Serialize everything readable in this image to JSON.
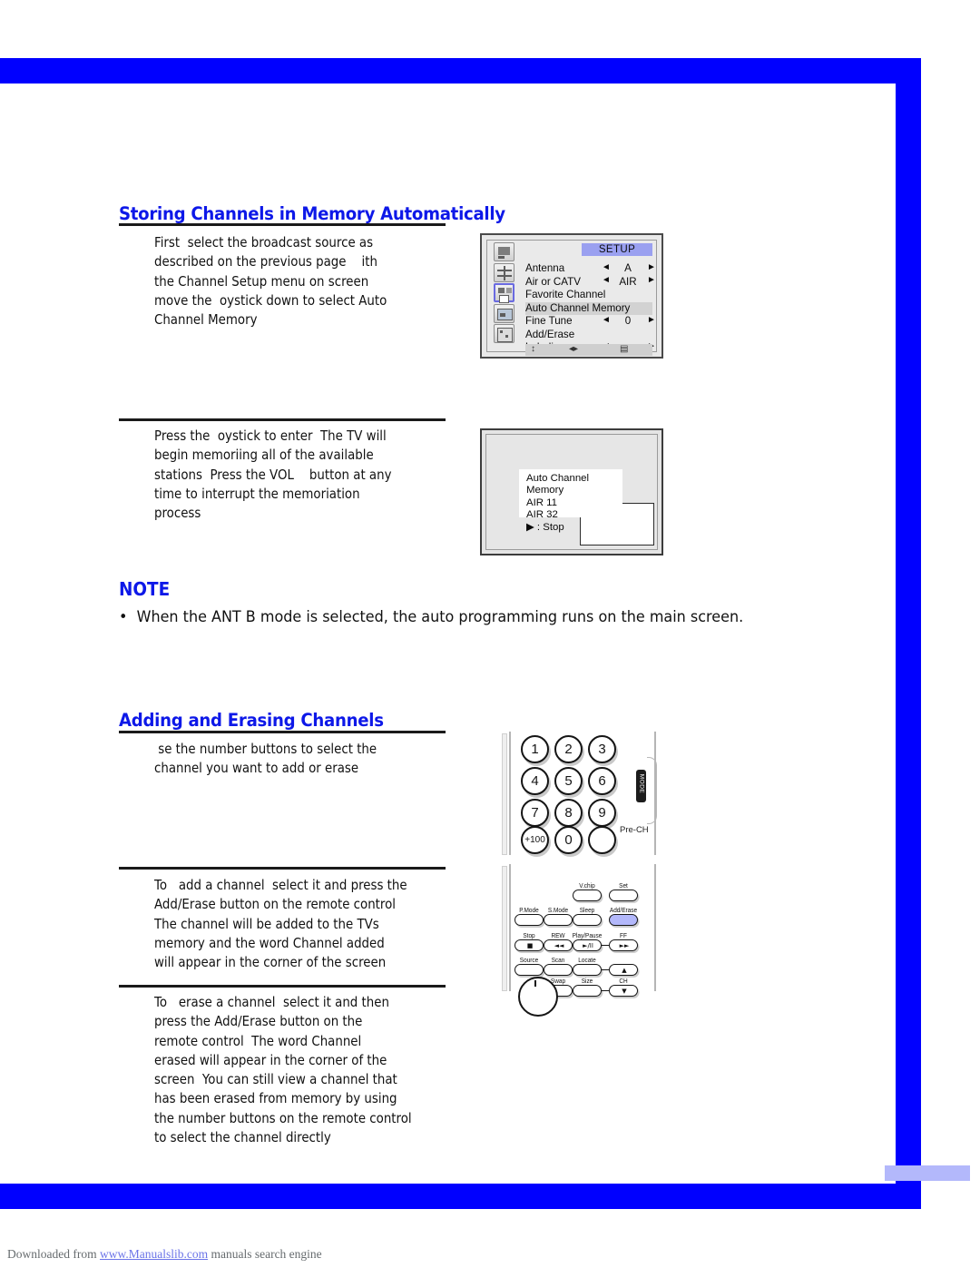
{
  "page": {
    "frame_color": "#0000ff",
    "accent_color": "#b3b8fb"
  },
  "sections": [
    {
      "id": "storing",
      "heading": "Storing Channels in Memory Automatically",
      "steps": [
        "First  select the broadcast source as\ndescribed on the previous page    ith\nthe Channel Setup menu on screen\nmove the  oystick down to select Auto\nChannel Memory",
        "Press the  oystick to enter  The TV will\nbegin memoriing all of the available\nstations  Press the VOL    button at any\ntime to interrupt the memoriation\nprocess"
      ]
    },
    {
      "id": "adding",
      "heading": "Adding and Erasing Channels",
      "steps": [
        " se the number buttons to select the\nchannel you want to add or erase",
        "To   add a channel  select it and press the\nAdd/Erase button on the remote control\nThe channel will be added to the TVs\nmemory and the word Channel added\nwill appear in the corner of the screen",
        "To   erase a channel  select it and then\npress the Add/Erase button on the\nremote control  The word Channel\nerased will appear in the corner of the\nscreen  You can still view a channel that\nhas been erased from memory by using\nthe number buttons on the remote control\nto select the channel directly"
      ]
    }
  ],
  "note": {
    "title": "NOTE",
    "bullet": "•  When the ANT B mode is selected, the auto programming runs on the main screen."
  },
  "tv_setup_screen": {
    "title": "SETUP",
    "rows": [
      {
        "label": "Antenna",
        "left": "◄",
        "value": "A",
        "right": "►",
        "highlighted": false
      },
      {
        "label": "Air or CATV",
        "left": "◄",
        "value": "AIR",
        "right": "►",
        "highlighted": false
      },
      {
        "label": "Favorite Channel",
        "left": "",
        "value": "",
        "right": "",
        "highlighted": false
      },
      {
        "label": "Auto Channel Memory",
        "left": "",
        "value": "",
        "right": "",
        "highlighted": true
      },
      {
        "label": "Fine Tune",
        "left": "◄",
        "value": "0",
        "right": "►",
        "highlighted": false
      },
      {
        "label": "Add/Erase",
        "left": "",
        "value": "",
        "right": "",
        "highlighted": false
      },
      {
        "label": "Labeling",
        "left": "◄",
        "value": "- - - -",
        "right": "►",
        "highlighted": false
      }
    ],
    "footer_glyphs": [
      "↕",
      "◀▶",
      "⌸"
    ],
    "sidebar_icons": [
      "picture-icon",
      "audio-icon",
      "channel-icon",
      "screen-icon",
      "function-icon"
    ],
    "selected_sidebar_index": 2
  },
  "tv_memory_screen": {
    "lines": [
      "Auto Channel Memory",
      "AIR 11",
      "AIR  32",
      "▶  :   Stop"
    ]
  },
  "remote_keypad": {
    "buttons": [
      [
        "1",
        "2",
        "3"
      ],
      [
        "4",
        "5",
        "6"
      ],
      [
        "7",
        "8",
        "9"
      ],
      [
        "+100",
        "0",
        ""
      ]
    ],
    "pre_ch_label": "Pre-CH",
    "mode_label": "MODE"
  },
  "remote_functions": {
    "row0": [
      {
        "label": "V.chip",
        "glyph": "",
        "highlighted": false
      },
      {
        "label": "Set",
        "glyph": "",
        "highlighted": false
      }
    ],
    "row1": [
      {
        "label": "P.Mode",
        "glyph": "",
        "highlighted": false
      },
      {
        "label": "S.Mode",
        "glyph": "",
        "highlighted": false
      },
      {
        "label": "Sleep",
        "glyph": "",
        "highlighted": false
      },
      {
        "label": "Add/Erase",
        "glyph": "",
        "highlighted": true
      }
    ],
    "row2": [
      {
        "label": "Stop",
        "glyph": "■",
        "highlighted": false
      },
      {
        "label": "REW",
        "glyph": "◄◄",
        "highlighted": false
      },
      {
        "label": "Play/Pause",
        "glyph": "►/II",
        "highlighted": false
      },
      {
        "label": "FF",
        "glyph": "►►",
        "highlighted": false
      }
    ],
    "row3": [
      {
        "label": "Source",
        "glyph": "",
        "highlighted": false
      },
      {
        "label": "Scan",
        "glyph": "",
        "highlighted": false
      },
      {
        "label": "Locate",
        "glyph": "",
        "highlighted": false
      },
      {
        "label": "",
        "glyph": "▲",
        "highlighted": false
      }
    ],
    "row4": [
      {
        "label": "Swap",
        "glyph": "",
        "highlighted": false
      },
      {
        "label": "Size",
        "glyph": "",
        "highlighted": false
      },
      {
        "label": "CH",
        "glyph": "▼",
        "highlighted": false
      }
    ]
  },
  "footer": {
    "prefix": "Downloaded from ",
    "link": "www.Manualslib.com",
    "suffix": " manuals search engine"
  }
}
